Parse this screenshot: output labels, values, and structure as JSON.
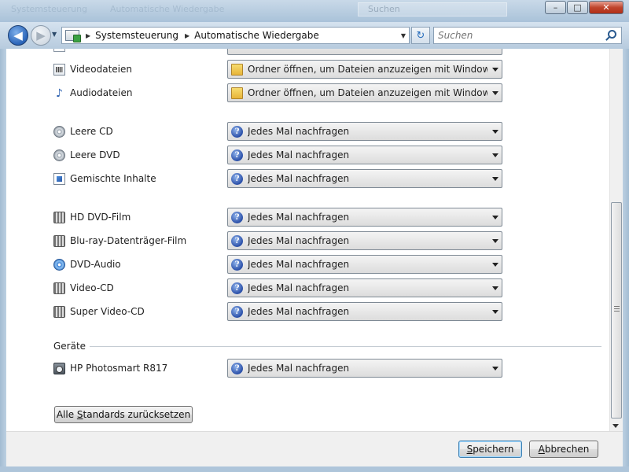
{
  "titlebar": {
    "ghost_back": "Systemsteuerung",
    "ghost_title": "Automatische Wiedergabe",
    "ghost_search": "Suchen",
    "minimize_glyph": "–",
    "maximize_glyph": "□",
    "close_glyph": "✕"
  },
  "nav": {
    "breadcrumbs": [
      "Systemsteuerung",
      "Automatische Wiedergabe"
    ],
    "search_placeholder": "Suchen"
  },
  "rows": [
    {
      "label": "Videodateien",
      "icon": "film-document-icon",
      "value": "Ordner öffnen, um Dateien anzuzeigen mit Windows-Explorer",
      "value_icon": "folder-icon"
    },
    {
      "label": "Audiodateien",
      "icon": "audio-note-icon",
      "value": "Ordner öffnen, um Dateien anzuzeigen mit Windows-Explorer",
      "value_icon": "folder-icon"
    },
    {
      "label": "Leere CD",
      "icon": "disc-icon",
      "value": "Jedes Mal nachfragen",
      "value_icon": "help-icon"
    },
    {
      "label": "Leere DVD",
      "icon": "disc-icon",
      "value": "Jedes Mal nachfragen",
      "value_icon": "help-icon"
    },
    {
      "label": "Gemischte Inhalte",
      "icon": "mixed-content-icon",
      "value": "Jedes Mal nachfragen",
      "value_icon": "help-icon"
    },
    {
      "label": "HD DVD-Film",
      "icon": "film-disc-icon",
      "value": "Jedes Mal nachfragen",
      "value_icon": "help-icon"
    },
    {
      "label": "Blu-ray-Datenträger-Film",
      "icon": "film-disc-icon",
      "value": "Jedes Mal nachfragen",
      "value_icon": "help-icon"
    },
    {
      "label": "DVD-Audio",
      "icon": "audio-disc-icon",
      "value": "Jedes Mal nachfragen",
      "value_icon": "help-icon"
    },
    {
      "label": "Video-CD",
      "icon": "film-disc-icon",
      "value": "Jedes Mal nachfragen",
      "value_icon": "help-icon"
    },
    {
      "label": "Super Video-CD",
      "icon": "film-disc-icon",
      "value": "Jedes Mal nachfragen",
      "value_icon": "help-icon"
    }
  ],
  "devices": {
    "header": "Geräte",
    "items": [
      {
        "label": "HP Photosmart R817",
        "icon": "camera-icon",
        "value": "Jedes Mal nachfragen",
        "value_icon": "help-icon"
      }
    ]
  },
  "buttons": {
    "reset_pre": "Alle ",
    "reset_key": "S",
    "reset_post": "tandards zurücksetzen",
    "save_pre": "",
    "save_key": "S",
    "save_post": "peichern",
    "cancel_pre": "",
    "cancel_key": "A",
    "cancel_post": "bbrechen"
  },
  "help_glyph": "?",
  "audio_glyph": "♪"
}
